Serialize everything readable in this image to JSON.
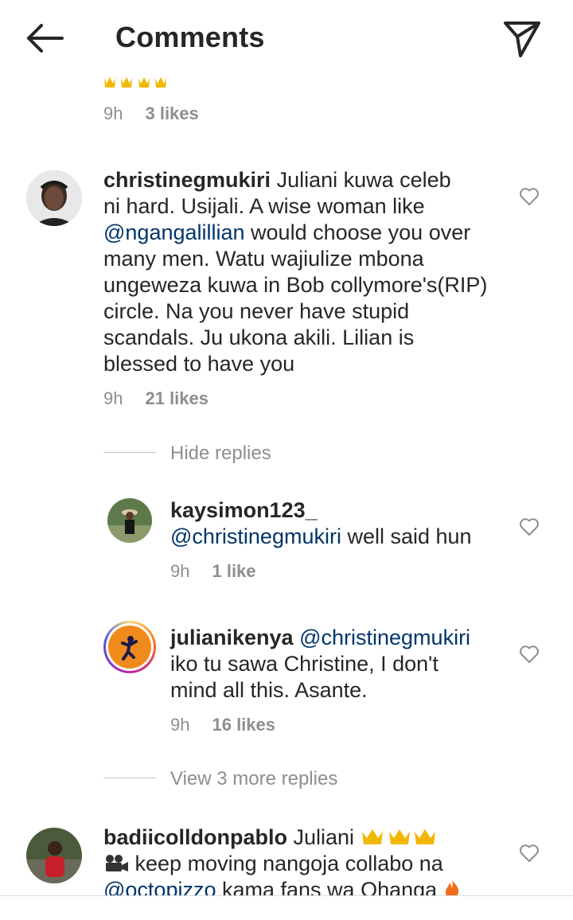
{
  "header": {
    "title": "Comments"
  },
  "top_comment": {
    "time": "9h",
    "likes": "3 likes"
  },
  "comments": [
    {
      "username": "christinegmukiri",
      "segments": [
        {
          "text": "Juliani kuwa celeb",
          "mention": false
        },
        {
          "text": "ni hard. Usijali. A wise woman like",
          "mention": false
        },
        {
          "text": "@ngangalillian",
          "mention": true
        },
        {
          "text": "would choose you over",
          "mention": false
        },
        {
          "text": "many men. Watu wajiulize mbona",
          "mention": false
        },
        {
          "text": "ungeweza kuwa in Bob collymore's(RIP)",
          "mention": false
        },
        {
          "text": "circle. Na you never have stupid",
          "mention": false
        },
        {
          "text": "scandals. Ju ukona akili. Lilian is",
          "mention": false
        },
        {
          "text": "blessed to have you",
          "mention": false
        }
      ],
      "time": "9h",
      "likes": "21 likes",
      "hide_replies": "Hide replies"
    }
  ],
  "replies": [
    {
      "username": "kaysimon123_",
      "mention": "@christinegmukiri",
      "text": "well said hun",
      "time": "9h",
      "likes": "1 like"
    },
    {
      "username": "julianikenya",
      "mention": "@christinegmukiri",
      "line2": "iko tu sawa Christine,  I don't",
      "line3": "mind all this. Asante.",
      "time": "9h",
      "likes": "16 likes"
    }
  ],
  "view_more": "View 3 more replies",
  "last_comment": {
    "username": "badiicolldonpablo",
    "text1": "Juliani",
    "line2": "keep moving nangoja collabo na",
    "mention": "@octopizzo",
    "line3_rest": "kama fans wa Ohanga"
  }
}
